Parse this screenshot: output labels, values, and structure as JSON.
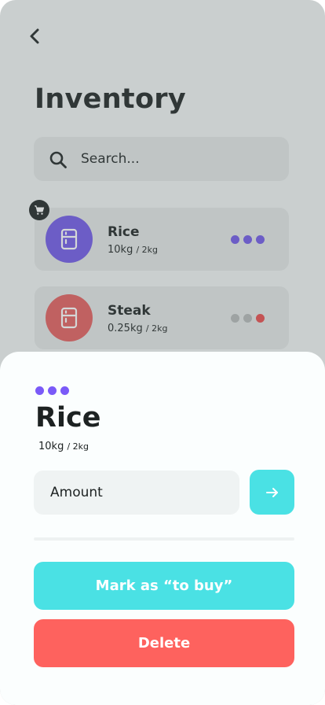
{
  "header": {
    "back_icon": "chevron-left-icon",
    "title": "Inventory"
  },
  "search": {
    "icon": "search-icon",
    "placeholder": "Search..."
  },
  "items": [
    {
      "name": "Rice",
      "amount": "10kg",
      "target": "/ 2kg",
      "icon": "fridge-icon",
      "avatar_color": "#6f57e8",
      "in_cart": true,
      "status_dots": [
        "#6f57e8",
        "#6f57e8",
        "#6f57e8"
      ]
    },
    {
      "name": "Steak",
      "amount": "0.25kg",
      "target": "/ 2kg",
      "icon": "fridge-icon",
      "avatar_color": "#e35c5c",
      "in_cart": false,
      "status_dots": [
        "#b4b8b8",
        "#b4b8b8",
        "#e9484a"
      ]
    }
  ],
  "cart_badge_icon": "cart-icon",
  "sheet": {
    "status_dots": [
      "#7a5af8",
      "#7a5af8",
      "#7a5af8"
    ],
    "title": "Rice",
    "amount": "10kg",
    "target": "/ 2kg",
    "amount_input": {
      "placeholder": "Amount",
      "value": ""
    },
    "submit_icon": "arrow-right-icon",
    "mark_to_buy_label": "Mark as “to buy”",
    "delete_label": "Delete"
  },
  "colors": {
    "accent_teal": "#4ae1e4",
    "danger_red": "#fe625e",
    "purple": "#6f57e8",
    "text_dark": "#1d2222"
  }
}
